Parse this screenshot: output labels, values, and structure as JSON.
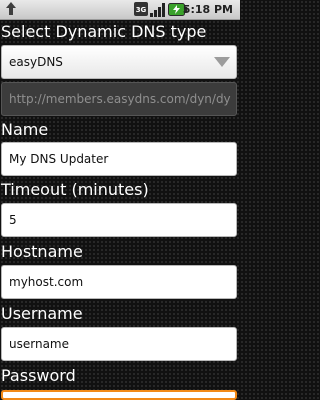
{
  "status_bar": {
    "time": "5:18 PM",
    "network_type": "3G",
    "icons": [
      "notification-icon",
      "3g-icon",
      "signal-bars-icon",
      "battery-charging-icon"
    ]
  },
  "form": {
    "dns_type_label": "Select Dynamic DNS type",
    "dns_type_value": "easyDNS",
    "update_url": "http://members.easydns.com/dyn/dy",
    "name_label": "Name",
    "name_value": "My DNS Updater",
    "timeout_label": "Timeout (minutes)",
    "timeout_value": "5",
    "hostname_label": "Hostname",
    "hostname_value": "myhost.com",
    "username_label": "Username",
    "username_value": "username",
    "password_label": "Password",
    "password_value": ""
  },
  "colors": {
    "focus_accent": "#f28a18",
    "battery_green": "#3aa12a"
  }
}
